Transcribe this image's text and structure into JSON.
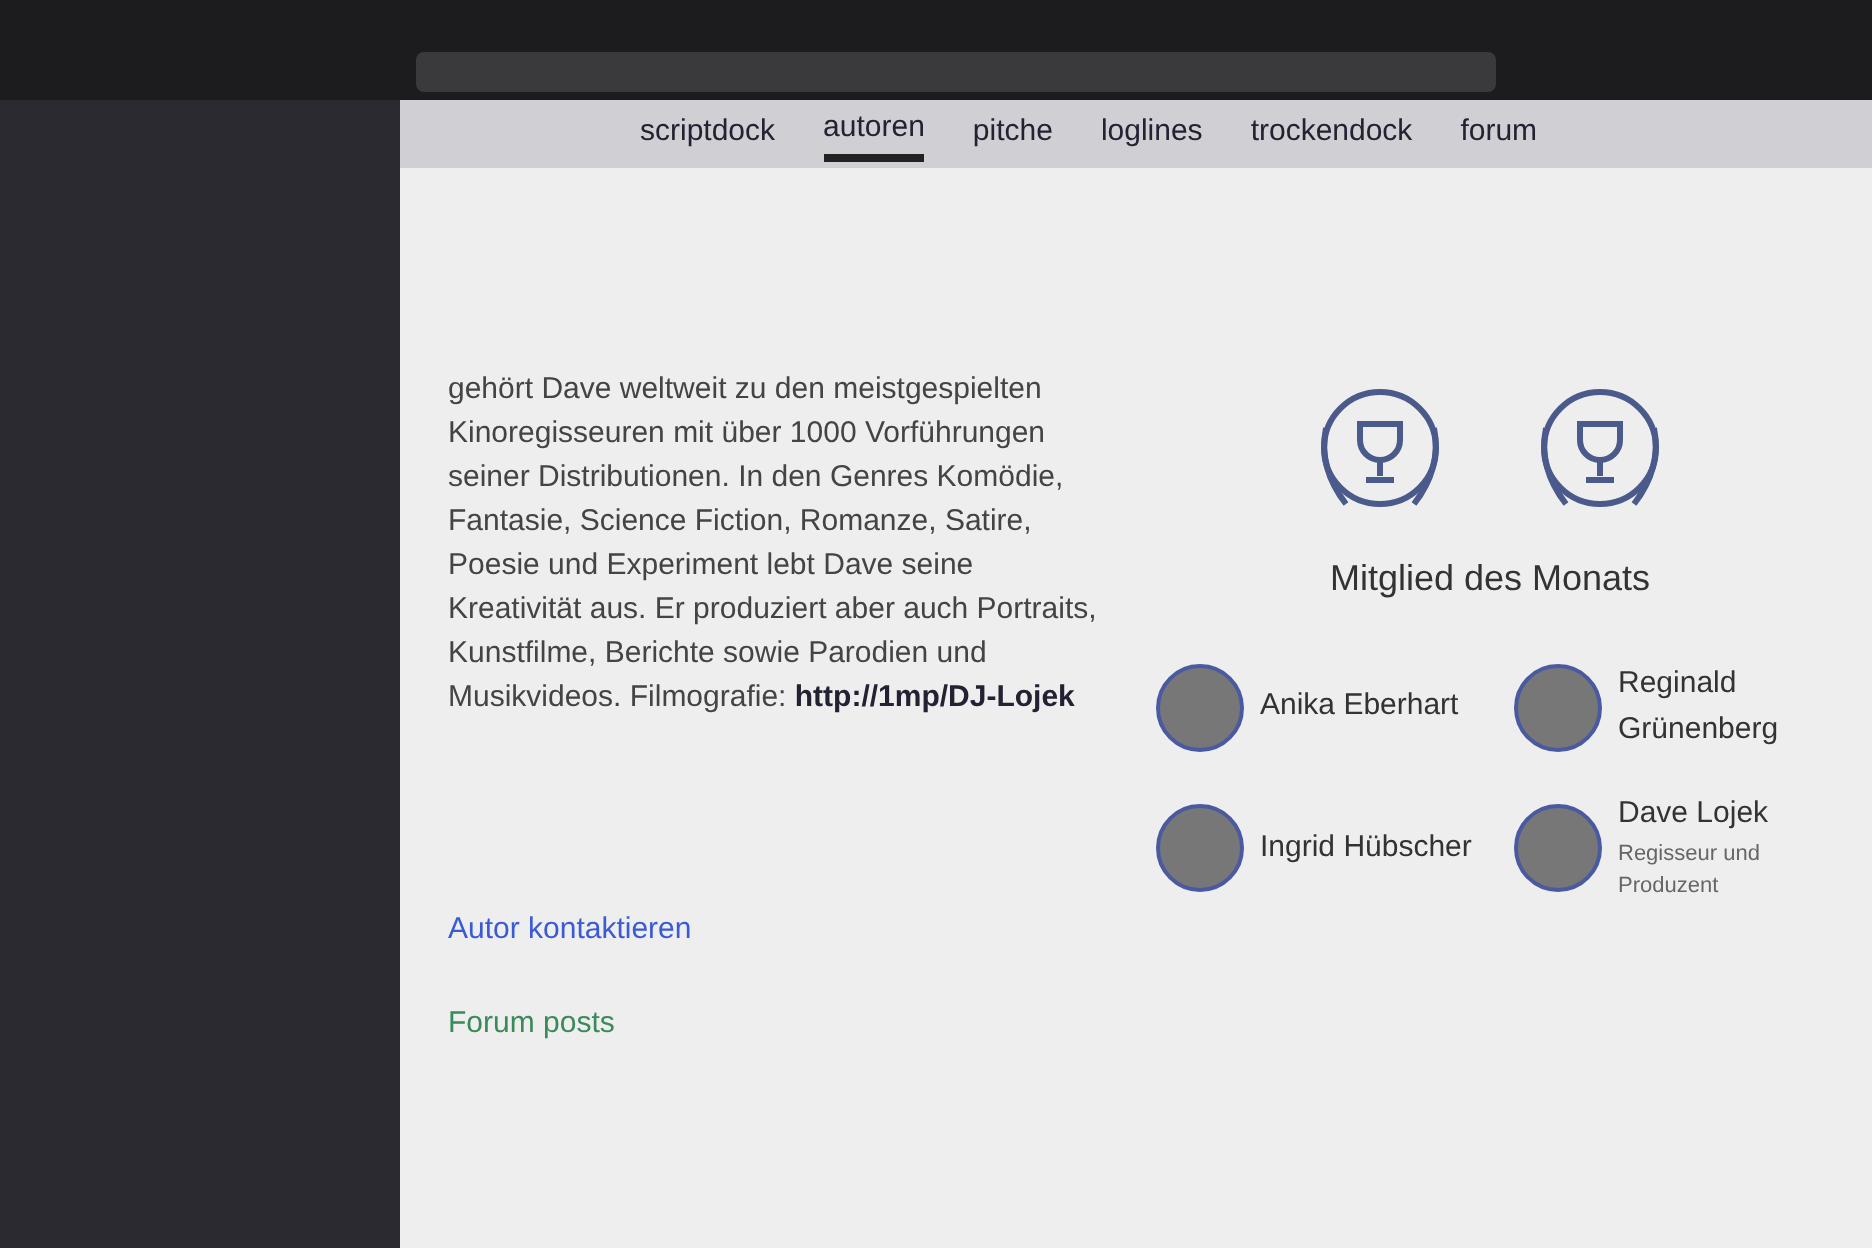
{
  "nav": [
    {
      "label": "scriptdock",
      "selected": false
    },
    {
      "label": "autoren",
      "selected": true
    },
    {
      "label": "pitche",
      "selected": false
    },
    {
      "label": "loglines",
      "selected": false
    },
    {
      "label": "trockendock",
      "selected": false
    },
    {
      "label": "forum",
      "selected": false
    }
  ],
  "bio": {
    "text": "gehört Dave weltweit zu den meistgespielten Kinoregisseuren mit über 1000 Vorführungen seiner Distributionen. In den Genres Komödie, Fantasie, Science Fiction, Romanze, Satire, Poesie und Experiment lebt Dave seine Kreativität aus. Er produziert aber auch Portraits, Kunstfilme, Berichte sowie Parodien und Musikvideos. Filmografie:",
    "link": "http://1mp/DJ-Lojek"
  },
  "member_of_month": {
    "title": "Mitglied des Monats"
  },
  "contact_link": "Autor kontaktieren",
  "forum_posts_title": "Forum posts",
  "members": [
    {
      "name": "Anika Eberhart"
    },
    {
      "name": "Reginald Grünenberg"
    },
    {
      "name": "Ingrid Hübscher"
    },
    {
      "name": "Dave Lojek",
      "subtitle": "Regisseur und Produzent"
    }
  ]
}
